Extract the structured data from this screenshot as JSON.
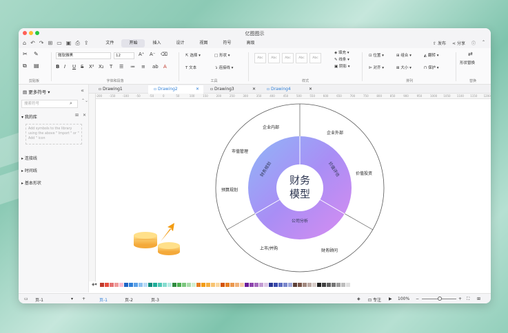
{
  "window": {
    "title": "亿图图示"
  },
  "menubar": {
    "tabs": [
      "文件",
      "开始",
      "插入",
      "设计",
      "视图",
      "符号",
      "高级"
    ],
    "active": "开始",
    "publish": "发布",
    "share": "分享"
  },
  "ribbon": {
    "font_name": "微软雅黑",
    "font_size": "12",
    "groups": {
      "clipboard": "剪贴板",
      "font": "字体和段落",
      "tools": "工具",
      "style": "样式",
      "arrange": "排列",
      "replace": "替换"
    },
    "tools": {
      "select": "选择",
      "shape": "形状",
      "text": "文本",
      "connector": "连接线"
    },
    "style_boxes": [
      "Abc",
      "Abc",
      "Abc",
      "Abc",
      "Abc"
    ],
    "fill": "填充",
    "line": "线条",
    "shadow": "阴影",
    "position": "位置",
    "group": "组合",
    "rotate": "翻转",
    "align": "对齐",
    "size": "大小",
    "protect": "保护",
    "replace_shape": "形状替换"
  },
  "sidebar": {
    "title": "更多符号",
    "search_placeholder": "搜索符号",
    "my_library": "我的库",
    "hint": "Add symbols to the library using the above \" Import \" or \" Add \" icon",
    "sections": [
      "连接线",
      "时间线",
      "基本形状"
    ]
  },
  "tabs": [
    "Drawing1",
    "Drawing2",
    "Drawing3",
    "Drawing4"
  ],
  "active_tab": "Drawing2",
  "ruler": [
    "-200",
    "-150",
    "-100",
    "-50",
    "-50",
    "0",
    "50",
    "100",
    "150",
    "200",
    "250",
    "300",
    "350",
    "400",
    "450",
    "500",
    "550",
    "600",
    "650",
    "700",
    "750",
    "800",
    "850",
    "900",
    "950",
    "1000",
    "1050",
    "1100",
    "1150",
    "1200"
  ],
  "diagram": {
    "center": [
      "财务",
      "模型"
    ],
    "inner": [
      "财务规划",
      "价值评估",
      "公司分析"
    ],
    "outer": [
      "企业内部",
      "企业外部",
      "市值管理",
      "价值投资",
      "预算规划",
      "上市/并购",
      "财务顾问"
    ]
  },
  "palette": [
    "#c0392b",
    "#e74c3c",
    "#e57373",
    "#ef9a9a",
    "#f8bbd0",
    "#1e63c4",
    "#2f7fd8",
    "#5aa0e8",
    "#8ec1f0",
    "#b9dbf7",
    "#0c8c7c",
    "#1fae9a",
    "#4fc7b5",
    "#85dccf",
    "#b7ece4",
    "#2e8b3e",
    "#4caf50",
    "#7bc67e",
    "#a9dba9",
    "#d2eed2",
    "#e67e22",
    "#f39c12",
    "#f5b041",
    "#f8c471",
    "#fad7a0",
    "#d35400",
    "#e67e22",
    "#eb984e",
    "#f0b27a",
    "#f5cba7",
    "#6a1b9a",
    "#8e44ad",
    "#a569bd",
    "#c39bd3",
    "#ddc6e6",
    "#283593",
    "#3949ab",
    "#5c6bc0",
    "#7986cb",
    "#9fa8da",
    "#5d4037",
    "#795548",
    "#a1887f",
    "#bcaaa4",
    "#d7ccc8",
    "#212121",
    "#424242",
    "#616161",
    "#757575",
    "#9e9e9e",
    "#bdbdbd",
    "#e0e0e0"
  ],
  "status": {
    "page_select": "页-1",
    "pages": [
      "页-1",
      "页-2",
      "页-3"
    ],
    "focus": "专注",
    "zoom": "100%"
  }
}
